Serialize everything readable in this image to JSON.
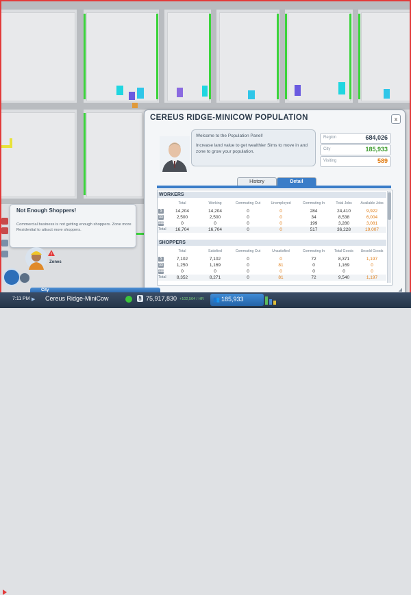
{
  "panel": {
    "title": "CEREUS RIDGE-MINICOW POPULATION",
    "close": "x",
    "speech": {
      "greeting": "Welcome to the Population Panel!",
      "message": "Increase land value to get wealthier Sims to move in and zone to grow your population."
    },
    "stats": [
      {
        "label": "Region",
        "value": "684,026",
        "color": "#2b3a4a"
      },
      {
        "label": "City",
        "value": "185,933",
        "color": "#3a9a2a"
      },
      {
        "label": "Visiting",
        "value": "589",
        "color": "#e07a10"
      }
    ],
    "tabs": {
      "history": "History",
      "detail": "Detail"
    },
    "workers": {
      "title": "WORKERS",
      "headers": [
        "Total",
        "Working",
        "Commuting Out",
        "Unemployed",
        "Commuting In",
        "Total Jobs",
        "Available Jobs"
      ],
      "rows": [
        {
          "icon": "$",
          "cells": [
            "14,204",
            "14,204",
            "0",
            "0",
            "284",
            "24,410",
            "9,922"
          ]
        },
        {
          "icon": "$$",
          "cells": [
            "2,500",
            "2,500",
            "0",
            "0",
            "34",
            "8,538",
            "6,004"
          ]
        },
        {
          "icon": "$$$",
          "cells": [
            "0",
            "0",
            "0",
            "0",
            "199",
            "3,280",
            "3,081"
          ]
        }
      ],
      "total_label": "Total",
      "total": [
        "16,704",
        "16,704",
        "0",
        "0",
        "517",
        "36,228",
        "19,007"
      ]
    },
    "shoppers": {
      "title": "SHOPPERS",
      "headers": [
        "Total",
        "Satisfied",
        "Commuting Out",
        "Unsatisfied",
        "Commuting In",
        "Total Goods",
        "Unsold Goods"
      ],
      "rows": [
        {
          "icon": "$",
          "cells": [
            "7,102",
            "7,102",
            "0",
            "0",
            "72",
            "8,371",
            "1,197"
          ]
        },
        {
          "icon": "$$",
          "cells": [
            "1,250",
            "1,169",
            "0",
            "81",
            "0",
            "1,169",
            "0"
          ]
        },
        {
          "icon": "$$$",
          "cells": [
            "0",
            "0",
            "0",
            "0",
            "0",
            "0",
            "0"
          ]
        }
      ],
      "total_label": "Total",
      "total": [
        "8,352",
        "8,271",
        "0",
        "81",
        "72",
        "9,540",
        "1,197"
      ]
    }
  },
  "notification": {
    "title": "Not Enough Shoppers!",
    "body": "Commercial business is not getting enough shoppers. Zone more Residential to attract more shoppers."
  },
  "advisor": {
    "label": "Zones",
    "warning": "!"
  },
  "bottom_bar": {
    "city_tab": "City",
    "time": "7:11 PM",
    "speed": "▶",
    "city_name": "Cereus Ridge-MiniCow",
    "sim_symbol": "§",
    "money": "75,917,830",
    "rate": "+102,564 / HR",
    "population": "185,933"
  },
  "colors": {
    "accent": "#3a7dc8",
    "orange": "#e07a10",
    "green": "#3a9a2a",
    "zone_green": "#3bd43b",
    "alert_red": "#e23a3a"
  }
}
